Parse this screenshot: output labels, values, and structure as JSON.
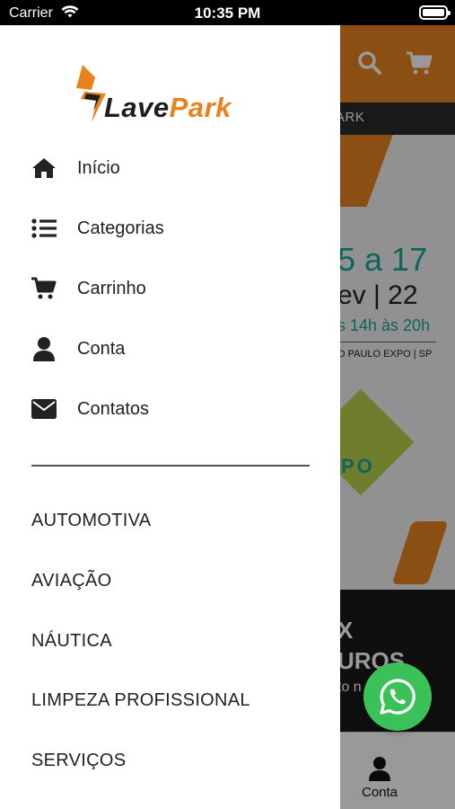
{
  "status_bar": {
    "carrier": "Carrier",
    "time": "10:35 PM"
  },
  "background": {
    "subnav_text": "ARK",
    "banner_dates": "5 a 17",
    "banner_month": "ev | 22",
    "banner_hours": "s 14h às 20h",
    "banner_venue": "O PAULO EXPO | SP",
    "banner_expo": "PO",
    "dark_line1": "X",
    "dark_line2": "UROS",
    "dark_line3": "to n",
    "tab_conta": "Conta",
    "accent_color": "#e88420"
  },
  "drawer": {
    "logo": {
      "part1": "Lave",
      "part2": "Park"
    },
    "menu": [
      {
        "label": "Início",
        "icon": "home-icon"
      },
      {
        "label": "Categorias",
        "icon": "list-icon"
      },
      {
        "label": "Carrinho",
        "icon": "cart-icon"
      },
      {
        "label": "Conta",
        "icon": "user-icon"
      },
      {
        "label": "Contatos",
        "icon": "envelope-icon"
      }
    ],
    "categories": [
      "AUTOMOTIVA",
      "AVIAÇÃO",
      "NÁUTICA",
      "LIMPEZA PROFISSIONAL",
      "SERVIÇOS"
    ]
  },
  "whatsapp": {
    "icon": "whatsapp-icon",
    "color": "#3ac259"
  }
}
